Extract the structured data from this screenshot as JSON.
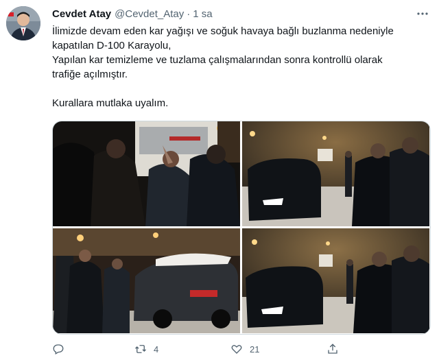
{
  "author": {
    "display_name": "Cevdet Atay",
    "handle": "@Cevdet_Atay",
    "separator": "·",
    "time": "1 sa"
  },
  "tweet": {
    "lines": [
      "İlimizde devam eden kar yağışı ve soğuk havaya bağlı  buzlanma nedeniyle",
      "kapatılan D-100 Karayolu,",
      "Yapılan kar temizleme ve tuzlama çalışmalarından sonra kontrollü olarak",
      "trafiğe açılmıştır.",
      "",
      "Kurallara mutlaka uyalım."
    ]
  },
  "metrics": {
    "retweets": "4",
    "likes": "21"
  },
  "icons": {
    "more": "more-icon",
    "reply": "reply-icon",
    "retweet": "retweet-icon",
    "like": "heart-icon",
    "share": "share-icon"
  },
  "colors": {
    "text": "#0f1419",
    "secondary": "#536471",
    "border": "#cfd9de"
  }
}
